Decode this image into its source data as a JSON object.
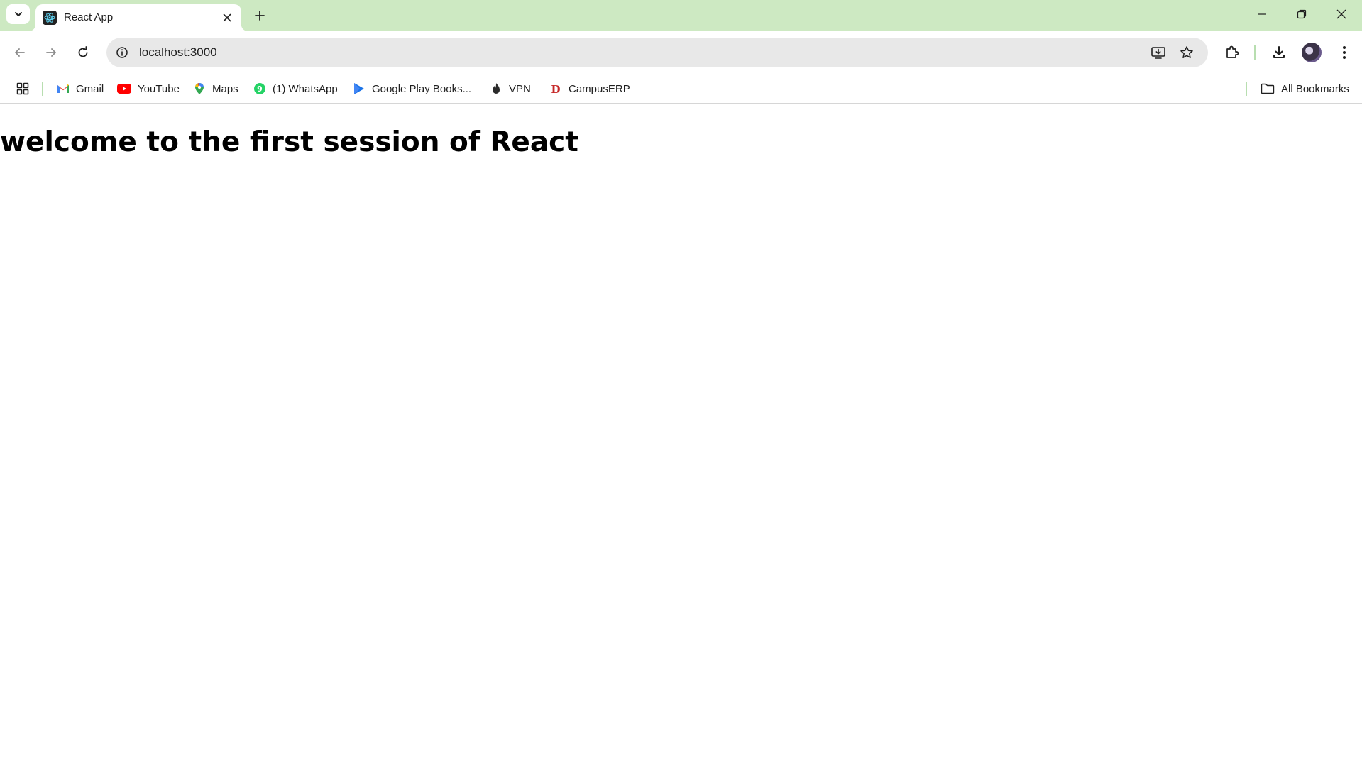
{
  "browser": {
    "tab": {
      "title": "React App",
      "favicon": "react-icon"
    },
    "window_controls": [
      "minimize-icon",
      "restore-icon",
      "close-icon"
    ],
    "toolbar": {
      "url": "localhost:3000",
      "icons": [
        "back-arrow-icon",
        "forward-arrow-icon",
        "reload-icon",
        "site-info-icon",
        "install-app-icon",
        "bookmark-star-icon",
        "extensions-icon",
        "downloads-icon",
        "profile-avatar",
        "menu-dots-icon"
      ]
    },
    "bookmarks": [
      {
        "label": "Gmail",
        "icon": "gmail-icon"
      },
      {
        "label": "YouTube",
        "icon": "youtube-icon"
      },
      {
        "label": "Maps",
        "icon": "maps-pin-icon"
      },
      {
        "label": "(1) WhatsApp",
        "icon": "whatsapp-icon"
      },
      {
        "label": "Google Play Books...",
        "icon": "play-books-icon"
      },
      {
        "label": "VPN",
        "icon": "vpn-flame-icon"
      },
      {
        "label": "CampusERP",
        "icon": "campuserp-icon"
      }
    ],
    "all_bookmarks_label": "All Bookmarks",
    "accent_color": "#cde9c2"
  },
  "page": {
    "heading": "welcome to the first session of React"
  }
}
